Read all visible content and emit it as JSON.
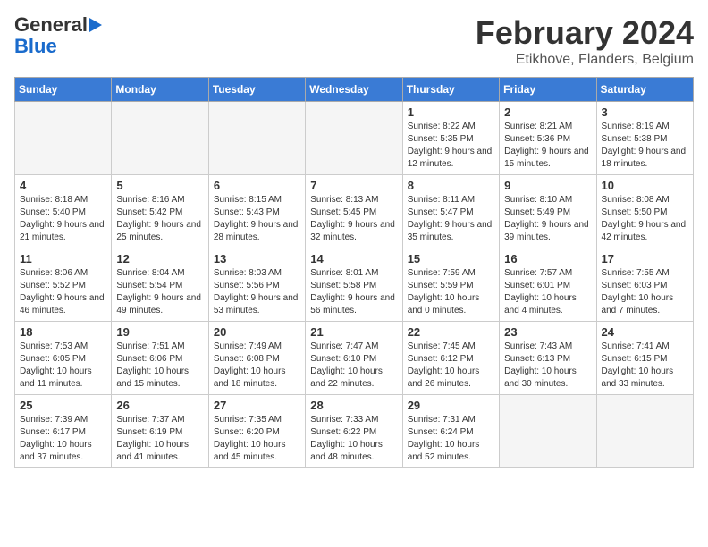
{
  "header": {
    "logo_line1": "General",
    "logo_line2": "Blue",
    "month_title": "February 2024",
    "location": "Etikhove, Flanders, Belgium"
  },
  "weekdays": [
    "Sunday",
    "Monday",
    "Tuesday",
    "Wednesday",
    "Thursday",
    "Friday",
    "Saturday"
  ],
  "weeks": [
    [
      {
        "day": "",
        "empty": true
      },
      {
        "day": "",
        "empty": true
      },
      {
        "day": "",
        "empty": true
      },
      {
        "day": "",
        "empty": true
      },
      {
        "day": "1",
        "sunrise": "8:22 AM",
        "sunset": "5:35 PM",
        "daylight": "9 hours and 12 minutes."
      },
      {
        "day": "2",
        "sunrise": "8:21 AM",
        "sunset": "5:36 PM",
        "daylight": "9 hours and 15 minutes."
      },
      {
        "day": "3",
        "sunrise": "8:19 AM",
        "sunset": "5:38 PM",
        "daylight": "9 hours and 18 minutes."
      }
    ],
    [
      {
        "day": "4",
        "sunrise": "8:18 AM",
        "sunset": "5:40 PM",
        "daylight": "9 hours and 21 minutes."
      },
      {
        "day": "5",
        "sunrise": "8:16 AM",
        "sunset": "5:42 PM",
        "daylight": "9 hours and 25 minutes."
      },
      {
        "day": "6",
        "sunrise": "8:15 AM",
        "sunset": "5:43 PM",
        "daylight": "9 hours and 28 minutes."
      },
      {
        "day": "7",
        "sunrise": "8:13 AM",
        "sunset": "5:45 PM",
        "daylight": "9 hours and 32 minutes."
      },
      {
        "day": "8",
        "sunrise": "8:11 AM",
        "sunset": "5:47 PM",
        "daylight": "9 hours and 35 minutes."
      },
      {
        "day": "9",
        "sunrise": "8:10 AM",
        "sunset": "5:49 PM",
        "daylight": "9 hours and 39 minutes."
      },
      {
        "day": "10",
        "sunrise": "8:08 AM",
        "sunset": "5:50 PM",
        "daylight": "9 hours and 42 minutes."
      }
    ],
    [
      {
        "day": "11",
        "sunrise": "8:06 AM",
        "sunset": "5:52 PM",
        "daylight": "9 hours and 46 minutes."
      },
      {
        "day": "12",
        "sunrise": "8:04 AM",
        "sunset": "5:54 PM",
        "daylight": "9 hours and 49 minutes."
      },
      {
        "day": "13",
        "sunrise": "8:03 AM",
        "sunset": "5:56 PM",
        "daylight": "9 hours and 53 minutes."
      },
      {
        "day": "14",
        "sunrise": "8:01 AM",
        "sunset": "5:58 PM",
        "daylight": "9 hours and 56 minutes."
      },
      {
        "day": "15",
        "sunrise": "7:59 AM",
        "sunset": "5:59 PM",
        "daylight": "10 hours and 0 minutes."
      },
      {
        "day": "16",
        "sunrise": "7:57 AM",
        "sunset": "6:01 PM",
        "daylight": "10 hours and 4 minutes."
      },
      {
        "day": "17",
        "sunrise": "7:55 AM",
        "sunset": "6:03 PM",
        "daylight": "10 hours and 7 minutes."
      }
    ],
    [
      {
        "day": "18",
        "sunrise": "7:53 AM",
        "sunset": "6:05 PM",
        "daylight": "10 hours and 11 minutes."
      },
      {
        "day": "19",
        "sunrise": "7:51 AM",
        "sunset": "6:06 PM",
        "daylight": "10 hours and 15 minutes."
      },
      {
        "day": "20",
        "sunrise": "7:49 AM",
        "sunset": "6:08 PM",
        "daylight": "10 hours and 18 minutes."
      },
      {
        "day": "21",
        "sunrise": "7:47 AM",
        "sunset": "6:10 PM",
        "daylight": "10 hours and 22 minutes."
      },
      {
        "day": "22",
        "sunrise": "7:45 AM",
        "sunset": "6:12 PM",
        "daylight": "10 hours and 26 minutes."
      },
      {
        "day": "23",
        "sunrise": "7:43 AM",
        "sunset": "6:13 PM",
        "daylight": "10 hours and 30 minutes."
      },
      {
        "day": "24",
        "sunrise": "7:41 AM",
        "sunset": "6:15 PM",
        "daylight": "10 hours and 33 minutes."
      }
    ],
    [
      {
        "day": "25",
        "sunrise": "7:39 AM",
        "sunset": "6:17 PM",
        "daylight": "10 hours and 37 minutes."
      },
      {
        "day": "26",
        "sunrise": "7:37 AM",
        "sunset": "6:19 PM",
        "daylight": "10 hours and 41 minutes."
      },
      {
        "day": "27",
        "sunrise": "7:35 AM",
        "sunset": "6:20 PM",
        "daylight": "10 hours and 45 minutes."
      },
      {
        "day": "28",
        "sunrise": "7:33 AM",
        "sunset": "6:22 PM",
        "daylight": "10 hours and 48 minutes."
      },
      {
        "day": "29",
        "sunrise": "7:31 AM",
        "sunset": "6:24 PM",
        "daylight": "10 hours and 52 minutes."
      },
      {
        "day": "",
        "empty": true
      },
      {
        "day": "",
        "empty": true
      }
    ]
  ]
}
